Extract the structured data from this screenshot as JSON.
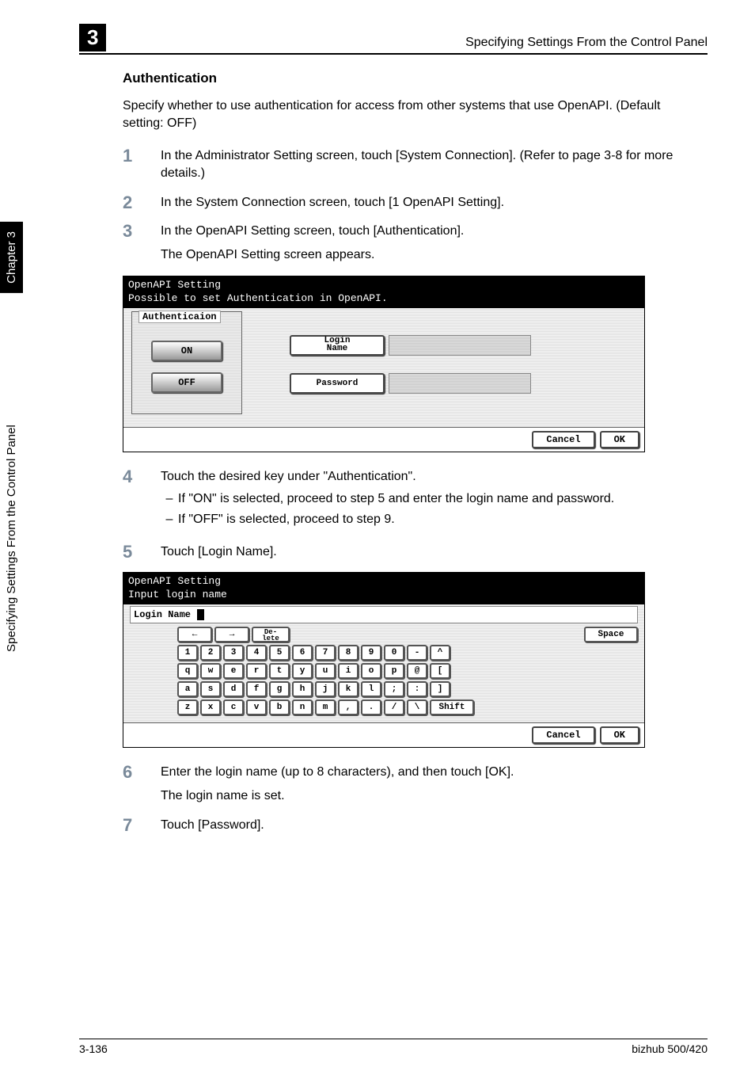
{
  "side": {
    "chapter": "Chapter 3",
    "section": "Specifying Settings From the Control Panel"
  },
  "header": {
    "chapter_num": "3",
    "title": "Specifying Settings From the Control Panel"
  },
  "content": {
    "section_title": "Authentication",
    "intro": "Specify whether to use authentication for access from other systems that use OpenAPI. (Default setting: OFF)",
    "steps": {
      "s1": "In the Administrator Setting screen, touch [System Connection]. (Refer to page 3-8 for more details.)",
      "s2": "In the System Connection screen, touch [1 OpenAPI Setting].",
      "s3a": "In the OpenAPI Setting screen, touch [Authentication].",
      "s3b": "The OpenAPI Setting screen appears.",
      "s4": "Touch the desired key under \"Authentication\".",
      "s4sub1": "If \"ON\" is selected, proceed to step 5 and enter the login name and password.",
      "s4sub2": "If \"OFF\" is selected, proceed to step 9.",
      "s5": "Touch [Login Name].",
      "s6a": "Enter the login name (up to 8 characters), and then touch [OK].",
      "s6b": "The login name is set.",
      "s7": "Touch [Password]."
    },
    "nums": {
      "n1": "1",
      "n2": "2",
      "n3": "3",
      "n4": "4",
      "n5": "5",
      "n6": "6",
      "n7": "7"
    }
  },
  "screen1": {
    "title1": "OpenAPI Setting",
    "title2": "Possible to set Authentication in OpenAPI.",
    "auth_label": "Authenticaion",
    "on": "ON",
    "off": "OFF",
    "login_name": "Login\nName",
    "password": "Password",
    "cancel": "Cancel",
    "ok": "OK"
  },
  "screen2": {
    "title1": "OpenAPI Setting",
    "title2": "Input login name",
    "login_name_label": "Login Name",
    "arrow_left": "←",
    "arrow_right": "→",
    "delete": "De-\nlete",
    "space": "Space",
    "shift": "Shift",
    "cancel": "Cancel",
    "ok": "OK",
    "row1": [
      "1",
      "2",
      "3",
      "4",
      "5",
      "6",
      "7",
      "8",
      "9",
      "0",
      "-",
      "^"
    ],
    "row2": [
      "q",
      "w",
      "e",
      "r",
      "t",
      "y",
      "u",
      "i",
      "o",
      "p",
      "@",
      "["
    ],
    "row3": [
      "a",
      "s",
      "d",
      "f",
      "g",
      "h",
      "j",
      "k",
      "l",
      ";",
      ":",
      "]"
    ],
    "row4": [
      "z",
      "x",
      "c",
      "v",
      "b",
      "n",
      "m",
      ",",
      ".",
      "/",
      "\\"
    ]
  },
  "footer": {
    "page": "3-136",
    "model": "bizhub 500/420"
  }
}
